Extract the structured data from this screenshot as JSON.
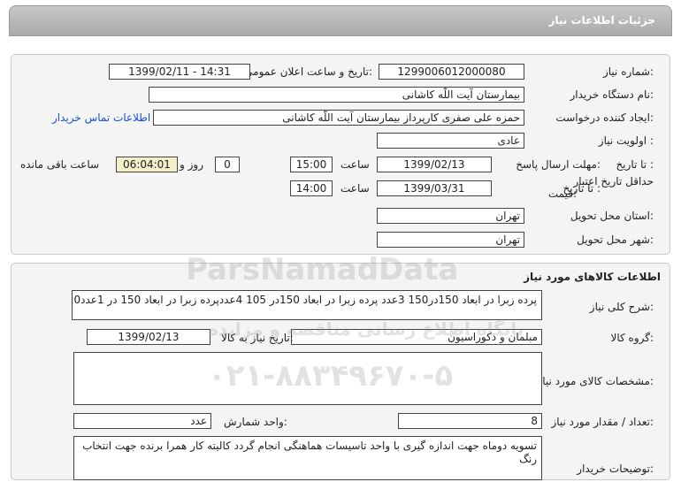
{
  "header": {
    "title": "جزئیات اطلاعات نیاز"
  },
  "info": {
    "need_number_label": "شماره نیاز:",
    "need_number": "1299006012000080",
    "announce_label": "تاریخ و ساعت اعلان عمومی:",
    "announce_value": "1399/02/11 - 14:31",
    "buyer_org_label": "نام دستگاه خریدار:",
    "buyer_org": "بیمارستان آیت اللّه کاشانی",
    "requester_label": "ایجاد کننده درخواست:",
    "requester": "حمزه علی صفری کارپرداز بیمارستان آیت اللّه کاشانی",
    "contact_link": "اطلاعات تماس خریدار",
    "priority_label": "اولویت نیاز :",
    "priority": "عادی",
    "deadline_label": "مهلت ارسال پاسخ:",
    "deadline_to": "تا تاریخ :",
    "deadline_date": "1399/02/13",
    "time_label": "ساعت",
    "deadline_time": "15:00",
    "days_value": "0",
    "days_label": "روز و",
    "remaining_value": "06:04:01",
    "remaining_label": "ساعت باقی مانده",
    "validity_label_1": "حداقل تاریخ اعتبار",
    "validity_label_2": "قیمت:",
    "validity_to": "تا تاریخ :",
    "validity_date": "1399/03/31",
    "validity_time_label": "ساعت",
    "validity_time": "14:00",
    "province_label": "استان محل تحویل:",
    "province": "تهران",
    "city_label": "شهر محل تحویل:",
    "city": "تهران"
  },
  "goods": {
    "section_title": "اطلاعات کالاهای مورد نیاز",
    "summary_label": "شرح کلی نیاز:",
    "summary": "پرده زبرا در ابعاد 150در150 3عدد پرده زبرا در ابعاد 150در 105 4عددپرده زبرا در ابعاد 150 در 1عدد120",
    "group_label": "گروه کالا:",
    "group": "مبلمان و دکوراسیون",
    "need_date_label": "تاریخ نیاز به کالا:",
    "need_date": "1399/02/13",
    "specs_label": "مشخصات کالای مورد نیاز:",
    "specs": "",
    "qty_label": "تعداد / مقدار مورد نیاز:",
    "qty": "8",
    "unit_label": "واحد شمارش:",
    "unit": "عدد",
    "buyer_desc_label": "توضیحات خریدار:",
    "buyer_desc": "تسویه دوماه جهت اندازه گیری با واحد تاسیسات هماهنگی انجام گردد کالیته کار همرا برنده جهت انتخاب رنگ"
  },
  "watermark": {
    "brand": "ParsNamadData",
    "line": "پایگاه اطلاع رسانی مناقصه و مزایده",
    "phone": "۰۲۱-۸۸۳۴۹۶۷۰-۵"
  }
}
